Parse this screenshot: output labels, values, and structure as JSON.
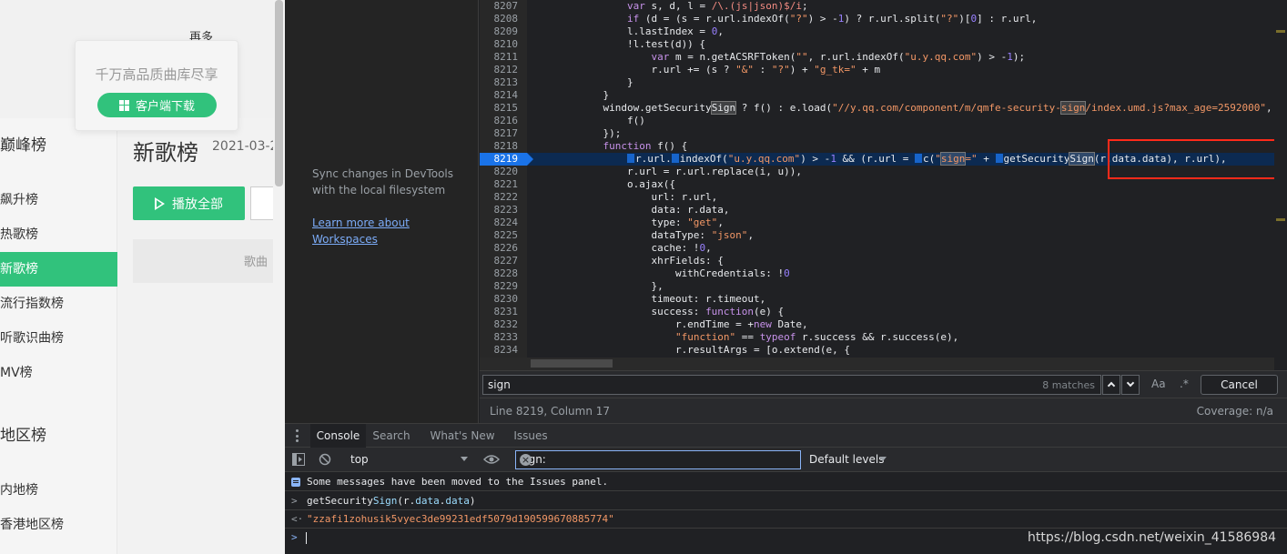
{
  "webpage": {
    "header_cut": "再多",
    "promo_text": "千万高品质曲库尽享",
    "download_button": "客户端下载",
    "sidebar": {
      "top_item": "巅峰榜",
      "items": [
        "飙升榜",
        "热歌榜",
        "新歌榜",
        "流行指数榜",
        "听歌识曲榜",
        "MV榜"
      ],
      "active": "新歌榜",
      "section2": "地区榜",
      "section2_items": [
        "内地榜",
        "香港地区榜"
      ]
    },
    "page_title": "新歌榜",
    "page_date": "2021-03-2",
    "play_all": "播放全部",
    "table_header_song": "歌曲"
  },
  "devtools": {
    "navigator": {
      "info": "Sync changes in DevTools with the local filesystem",
      "link": "Learn more about Workspaces"
    },
    "code_lines": [
      {
        "n": "8207",
        "html": "                <span class=\"tk-kw\">var</span> s, d, l = <span class=\"tk-re\">/\\.(js|json)$/i</span>;"
      },
      {
        "n": "8208",
        "html": "                <span class=\"tk-kw\">if</span> (d = (s = r.url.indexOf(<span class=\"tk-str\">\"?\"</span>) &gt; -<span class=\"tk-num\">1</span>) ? r.url.split(<span class=\"tk-str\">\"?\"</span>)[<span class=\"tk-num\">0</span>] : r.url,"
      },
      {
        "n": "8209",
        "html": "                l.lastIndex = <span class=\"tk-num\">0</span>,"
      },
      {
        "n": "8210",
        "html": "                !l.test(d)) {"
      },
      {
        "n": "8211",
        "html": "                    <span class=\"tk-kw\">var</span> m = n.getACSRFToken(<span class=\"tk-str\">\"\"</span>, r.url.indexOf(<span class=\"tk-str\">\"u.y.qq.com\"</span>) &gt; -<span class=\"tk-num\">1</span>);"
      },
      {
        "n": "8212",
        "html": "                    r.url += (s ? <span class=\"tk-str\">\"&amp;\"</span> : <span class=\"tk-str\">\"?\"</span>) + <span class=\"tk-str\">\"g_tk=\"</span> + m"
      },
      {
        "n": "8213",
        "html": "                }"
      },
      {
        "n": "8214",
        "html": "            }"
      },
      {
        "n": "8215",
        "html": "            window.getSecurity<span class=\"tk-hl\">Sign</span> ? f() : e.load(<span class=\"tk-str\">\"//y.qq.com/component/m/qmfe-security-<span class=\"tk-hl\">sign</span>/index.umd.js?max_age=2592000\"</span>,"
      },
      {
        "n": "8216",
        "html": "                f()"
      },
      {
        "n": "8217",
        "html": "            });"
      },
      {
        "n": "8218",
        "html": "            <span class=\"tk-kw\">function</span> f() {"
      },
      {
        "n": "8219",
        "html": "                <span class=\"bp\"></span>r.url.<span class=\"bp\"></span>indexOf(<span class=\"tk-str\">\"u.y.qq.com\"</span>) &gt; -<span class=\"tk-num\">1</span> &amp;&amp; (r.url = <span class=\"bp\"></span>c(<span class=\"tk-str\">\"<span class=\"tk-hl\">sign</span>=\"</span> + <span class=\"bp\"></span>getSecurity<span class=\"tk-hl\">Sign</span>(r.data.data), r.url),"
      },
      {
        "n": "8220",
        "html": "                r.url = r.url.replace(i, u)),"
      },
      {
        "n": "8221",
        "html": "                o.ajax({"
      },
      {
        "n": "8222",
        "html": "                    url: r.url,"
      },
      {
        "n": "8223",
        "html": "                    data: r.data,"
      },
      {
        "n": "8224",
        "html": "                    type: <span class=\"tk-str\">\"get\"</span>,"
      },
      {
        "n": "8225",
        "html": "                    dataType: <span class=\"tk-str\">\"json\"</span>,"
      },
      {
        "n": "8226",
        "html": "                    cache: !<span class=\"tk-num\">0</span>,"
      },
      {
        "n": "8227",
        "html": "                    xhrFields: {"
      },
      {
        "n": "8228",
        "html": "                        withCredentials: !<span class=\"tk-num\">0</span>"
      },
      {
        "n": "8229",
        "html": "                    },"
      },
      {
        "n": "8230",
        "html": "                    timeout: r.timeout,"
      },
      {
        "n": "8231",
        "html": "                    success: <span class=\"tk-kw\">function</span>(e) {"
      },
      {
        "n": "8232",
        "html": "                        r.endTime = +<span class=\"tk-kw\">new</span> Date,"
      },
      {
        "n": "8233",
        "html": "                        <span class=\"tk-str\">\"function\"</span> == <span class=\"tk-kw\">typeof</span> r.success &amp;&amp; r.success(e),"
      },
      {
        "n": "8234",
        "html": "                        r.resultArgs = [o.extend(e, {"
      },
      {
        "n": "8235",
        "html": ""
      }
    ],
    "active_line": "8219",
    "search": {
      "query": "sign",
      "matches": "8 matches",
      "match_case": "Aa",
      "regex": ".*",
      "cancel": "Cancel"
    },
    "status": {
      "position": "Line 8219, Column 17",
      "coverage": "Coverage: n/a"
    },
    "drawer": {
      "tabs": [
        "Console",
        "Search",
        "What's New",
        "Issues"
      ],
      "active_tab": "Console",
      "context": "top",
      "filter": "sign:",
      "levels": "Default levels",
      "messages": [
        {
          "type": "info",
          "text": "Some messages have been moved to the Issues panel."
        },
        {
          "type": "input",
          "glyph": ">",
          "html": "getSecurity<span class=\"prop\">Sign</span>(r.<span class=\"prop\">data</span>.<span class=\"prop\">data</span>)"
        },
        {
          "type": "output",
          "glyph": "<·",
          "html": "<span class=\"str\">\"zzafi1zohusik5vyec3de99231edf5079d190599670885774\"</span>"
        }
      ],
      "prompt_glyph": ">"
    },
    "watermark": "https://blog.csdn.net/weixin_41586984"
  },
  "colors": {
    "qq_green": "#31c27c",
    "devtools_bg": "#202124",
    "highlight_box": "#ff2a1a",
    "link": "#7cacf8"
  }
}
